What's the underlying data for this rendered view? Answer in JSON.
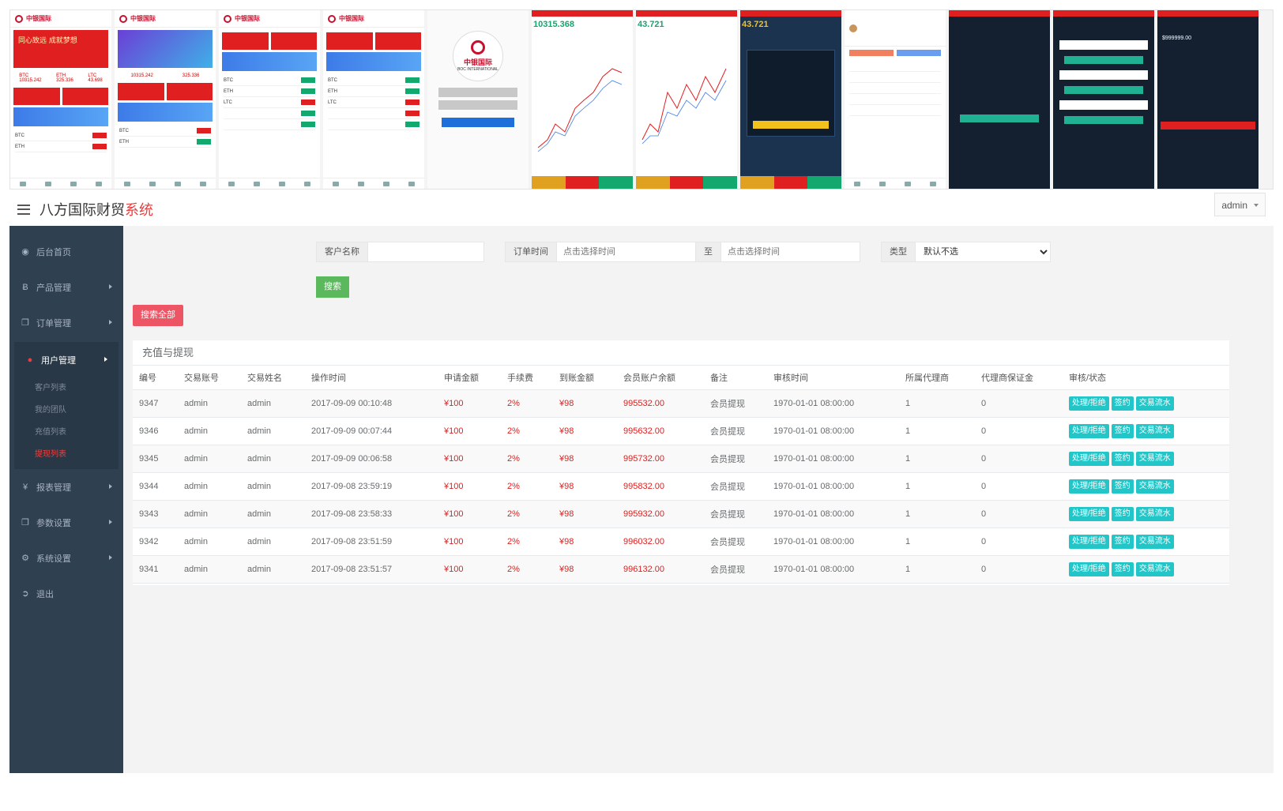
{
  "thumbnails": {
    "home": {
      "logo_text": "中银国际",
      "banner_text": "同心致远 成就梦想",
      "kpi_btc_label": "BTC",
      "kpi_btc_value": "10315.242",
      "kpi_eth_label": "ETH",
      "kpi_eth_value": "325.336",
      "kpi_ltc_label": "LTC",
      "kpi_ltc_value": "43.698"
    },
    "login": {
      "logo_text": "中银国际",
      "logo_sub": "BOC INTERNATIONAL"
    },
    "chart_btc": {
      "price": "10315.368"
    },
    "chart_ltc": {
      "price": "43.721"
    },
    "chart_ltc2": {
      "price": "43.721"
    },
    "dark_balance": {
      "value": "$999999.00"
    }
  },
  "header": {
    "brand_main": "八方国际财贸",
    "brand_accent": "系统",
    "user_label": "admin"
  },
  "sidebar": {
    "items": [
      {
        "label": "后台首页",
        "icon": "dashboard-icon"
      },
      {
        "label": "产品管理",
        "icon": "bitcoin-icon"
      },
      {
        "label": "订单管理",
        "icon": "copy-icon"
      },
      {
        "label": "用户管理",
        "icon": "user-icon"
      },
      {
        "label": "报表管理",
        "icon": "yen-icon"
      },
      {
        "label": "参数设置",
        "icon": "copy-icon"
      },
      {
        "label": "系统设置",
        "icon": "gears-icon"
      },
      {
        "label": "退出",
        "icon": "logout-icon"
      }
    ],
    "sub_items": [
      "客户列表",
      "我的团队",
      "充值列表",
      "提现列表"
    ]
  },
  "filters": {
    "customer_label": "客户名称",
    "customer_value": "",
    "order_time_label": "订单时间",
    "time_placeholder": "点击选择时间",
    "to_label": "至",
    "type_label": "类型",
    "type_selected": "默认不选",
    "search_button": "搜索",
    "search_all_button": "搜索全部"
  },
  "table": {
    "title": "充值与提现",
    "columns": [
      "编号",
      "交易账号",
      "交易姓名",
      "操作时间",
      "申请金额",
      "手续费",
      "到账金额",
      "会员账户余额",
      "备注",
      "审核时间",
      "所属代理商",
      "代理商保证金",
      "审核/状态"
    ],
    "action_labels": [
      "处理/拒绝",
      "签约",
      "交易流水"
    ],
    "rows": [
      {
        "id": "9347",
        "account": "admin",
        "name": "admin",
        "time": "2017-09-09 00:10:48",
        "amount": "¥100",
        "fee": "2%",
        "received": "¥98",
        "balance": "995532.00",
        "note": "会员提现",
        "audit_time": "1970-01-01 08:00:00",
        "agent": "1",
        "deposit": "0"
      },
      {
        "id": "9346",
        "account": "admin",
        "name": "admin",
        "time": "2017-09-09 00:07:44",
        "amount": "¥100",
        "fee": "2%",
        "received": "¥98",
        "balance": "995632.00",
        "note": "会员提现",
        "audit_time": "1970-01-01 08:00:00",
        "agent": "1",
        "deposit": "0"
      },
      {
        "id": "9345",
        "account": "admin",
        "name": "admin",
        "time": "2017-09-09 00:06:58",
        "amount": "¥100",
        "fee": "2%",
        "received": "¥98",
        "balance": "995732.00",
        "note": "会员提现",
        "audit_time": "1970-01-01 08:00:00",
        "agent": "1",
        "deposit": "0"
      },
      {
        "id": "9344",
        "account": "admin",
        "name": "admin",
        "time": "2017-09-08 23:59:19",
        "amount": "¥100",
        "fee": "2%",
        "received": "¥98",
        "balance": "995832.00",
        "note": "会员提现",
        "audit_time": "1970-01-01 08:00:00",
        "agent": "1",
        "deposit": "0"
      },
      {
        "id": "9343",
        "account": "admin",
        "name": "admin",
        "time": "2017-09-08 23:58:33",
        "amount": "¥100",
        "fee": "2%",
        "received": "¥98",
        "balance": "995932.00",
        "note": "会员提现",
        "audit_time": "1970-01-01 08:00:00",
        "agent": "1",
        "deposit": "0"
      },
      {
        "id": "9342",
        "account": "admin",
        "name": "admin",
        "time": "2017-09-08 23:51:59",
        "amount": "¥100",
        "fee": "2%",
        "received": "¥98",
        "balance": "996032.00",
        "note": "会员提现",
        "audit_time": "1970-01-01 08:00:00",
        "agent": "1",
        "deposit": "0"
      },
      {
        "id": "9341",
        "account": "admin",
        "name": "admin",
        "time": "2017-09-08 23:51:57",
        "amount": "¥100",
        "fee": "2%",
        "received": "¥98",
        "balance": "996132.00",
        "note": "会员提现",
        "audit_time": "1970-01-01 08:00:00",
        "agent": "1",
        "deposit": "0"
      }
    ]
  },
  "colors": {
    "sidebar_bg": "#2f4050",
    "accent_red": "#e84040",
    "search_green": "#5cb85c",
    "search_all_red": "#ed5565",
    "action_teal": "#23c6c8"
  }
}
